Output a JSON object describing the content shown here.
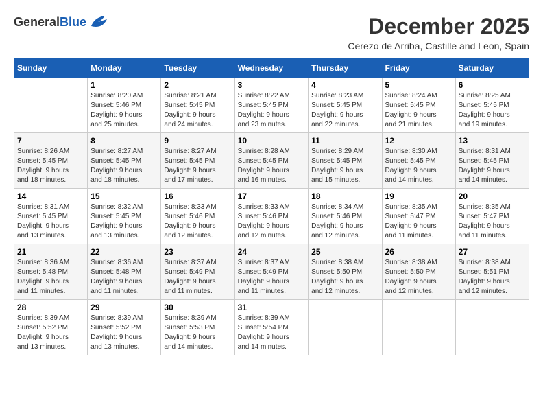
{
  "header": {
    "logo_general": "General",
    "logo_blue": "Blue",
    "month": "December 2025",
    "location": "Cerezo de Arriba, Castille and Leon, Spain"
  },
  "weekdays": [
    "Sunday",
    "Monday",
    "Tuesday",
    "Wednesday",
    "Thursday",
    "Friday",
    "Saturday"
  ],
  "weeks": [
    [
      {
        "day": "",
        "info": ""
      },
      {
        "day": "1",
        "info": "Sunrise: 8:20 AM\nSunset: 5:46 PM\nDaylight: 9 hours\nand 25 minutes."
      },
      {
        "day": "2",
        "info": "Sunrise: 8:21 AM\nSunset: 5:45 PM\nDaylight: 9 hours\nand 24 minutes."
      },
      {
        "day": "3",
        "info": "Sunrise: 8:22 AM\nSunset: 5:45 PM\nDaylight: 9 hours\nand 23 minutes."
      },
      {
        "day": "4",
        "info": "Sunrise: 8:23 AM\nSunset: 5:45 PM\nDaylight: 9 hours\nand 22 minutes."
      },
      {
        "day": "5",
        "info": "Sunrise: 8:24 AM\nSunset: 5:45 PM\nDaylight: 9 hours\nand 21 minutes."
      },
      {
        "day": "6",
        "info": "Sunrise: 8:25 AM\nSunset: 5:45 PM\nDaylight: 9 hours\nand 19 minutes."
      }
    ],
    [
      {
        "day": "7",
        "info": "Sunrise: 8:26 AM\nSunset: 5:45 PM\nDaylight: 9 hours\nand 18 minutes."
      },
      {
        "day": "8",
        "info": "Sunrise: 8:27 AM\nSunset: 5:45 PM\nDaylight: 9 hours\nand 18 minutes."
      },
      {
        "day": "9",
        "info": "Sunrise: 8:27 AM\nSunset: 5:45 PM\nDaylight: 9 hours\nand 17 minutes."
      },
      {
        "day": "10",
        "info": "Sunrise: 8:28 AM\nSunset: 5:45 PM\nDaylight: 9 hours\nand 16 minutes."
      },
      {
        "day": "11",
        "info": "Sunrise: 8:29 AM\nSunset: 5:45 PM\nDaylight: 9 hours\nand 15 minutes."
      },
      {
        "day": "12",
        "info": "Sunrise: 8:30 AM\nSunset: 5:45 PM\nDaylight: 9 hours\nand 14 minutes."
      },
      {
        "day": "13",
        "info": "Sunrise: 8:31 AM\nSunset: 5:45 PM\nDaylight: 9 hours\nand 14 minutes."
      }
    ],
    [
      {
        "day": "14",
        "info": "Sunrise: 8:31 AM\nSunset: 5:45 PM\nDaylight: 9 hours\nand 13 minutes."
      },
      {
        "day": "15",
        "info": "Sunrise: 8:32 AM\nSunset: 5:45 PM\nDaylight: 9 hours\nand 13 minutes."
      },
      {
        "day": "16",
        "info": "Sunrise: 8:33 AM\nSunset: 5:46 PM\nDaylight: 9 hours\nand 12 minutes."
      },
      {
        "day": "17",
        "info": "Sunrise: 8:33 AM\nSunset: 5:46 PM\nDaylight: 9 hours\nand 12 minutes."
      },
      {
        "day": "18",
        "info": "Sunrise: 8:34 AM\nSunset: 5:46 PM\nDaylight: 9 hours\nand 12 minutes."
      },
      {
        "day": "19",
        "info": "Sunrise: 8:35 AM\nSunset: 5:47 PM\nDaylight: 9 hours\nand 11 minutes."
      },
      {
        "day": "20",
        "info": "Sunrise: 8:35 AM\nSunset: 5:47 PM\nDaylight: 9 hours\nand 11 minutes."
      }
    ],
    [
      {
        "day": "21",
        "info": "Sunrise: 8:36 AM\nSunset: 5:48 PM\nDaylight: 9 hours\nand 11 minutes."
      },
      {
        "day": "22",
        "info": "Sunrise: 8:36 AM\nSunset: 5:48 PM\nDaylight: 9 hours\nand 11 minutes."
      },
      {
        "day": "23",
        "info": "Sunrise: 8:37 AM\nSunset: 5:49 PM\nDaylight: 9 hours\nand 11 minutes."
      },
      {
        "day": "24",
        "info": "Sunrise: 8:37 AM\nSunset: 5:49 PM\nDaylight: 9 hours\nand 11 minutes."
      },
      {
        "day": "25",
        "info": "Sunrise: 8:38 AM\nSunset: 5:50 PM\nDaylight: 9 hours\nand 12 minutes."
      },
      {
        "day": "26",
        "info": "Sunrise: 8:38 AM\nSunset: 5:50 PM\nDaylight: 9 hours\nand 12 minutes."
      },
      {
        "day": "27",
        "info": "Sunrise: 8:38 AM\nSunset: 5:51 PM\nDaylight: 9 hours\nand 12 minutes."
      }
    ],
    [
      {
        "day": "28",
        "info": "Sunrise: 8:39 AM\nSunset: 5:52 PM\nDaylight: 9 hours\nand 13 minutes."
      },
      {
        "day": "29",
        "info": "Sunrise: 8:39 AM\nSunset: 5:52 PM\nDaylight: 9 hours\nand 13 minutes."
      },
      {
        "day": "30",
        "info": "Sunrise: 8:39 AM\nSunset: 5:53 PM\nDaylight: 9 hours\nand 14 minutes."
      },
      {
        "day": "31",
        "info": "Sunrise: 8:39 AM\nSunset: 5:54 PM\nDaylight: 9 hours\nand 14 minutes."
      },
      {
        "day": "",
        "info": ""
      },
      {
        "day": "",
        "info": ""
      },
      {
        "day": "",
        "info": ""
      }
    ]
  ]
}
